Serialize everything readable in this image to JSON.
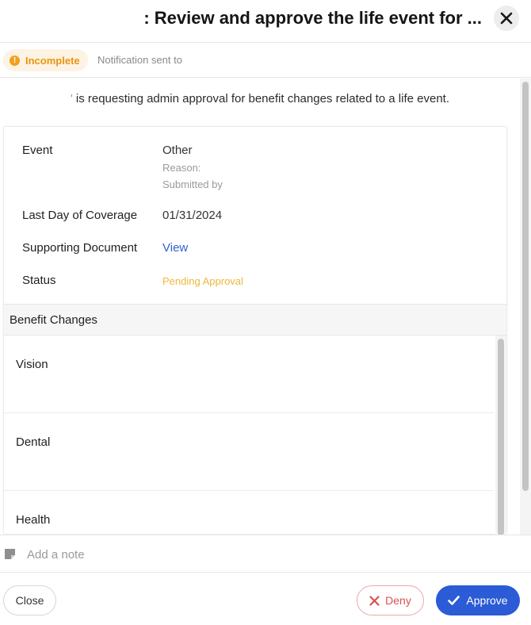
{
  "header": {
    "title": ": Review and approve the life event for ..."
  },
  "status": {
    "badge": "Incomplete",
    "notification": "Notification sent to"
  },
  "intro": {
    "tick": "'",
    "text": "is requesting admin approval for benefit changes related to a life event."
  },
  "details": {
    "event_label": "Event",
    "event_value": "Other",
    "reason": "Reason:",
    "submitted_by": "Submitted by",
    "coverage_label": "Last Day of Coverage",
    "coverage_value": "01/31/2024",
    "document_label": "Supporting Document",
    "document_link": "View",
    "status_label": "Status",
    "status_value": "Pending Approval"
  },
  "benefit_changes": {
    "title": "Benefit Changes",
    "items": [
      "Vision",
      "Dental",
      "Health"
    ]
  },
  "note": {
    "placeholder": "Add a note"
  },
  "footer": {
    "close": "Close",
    "deny": "Deny",
    "approve": "Approve"
  },
  "colors": {
    "accent": "#2c5bd6",
    "warning": "#e8950f",
    "pending": "#eeb73b",
    "deny": "#d95050"
  }
}
